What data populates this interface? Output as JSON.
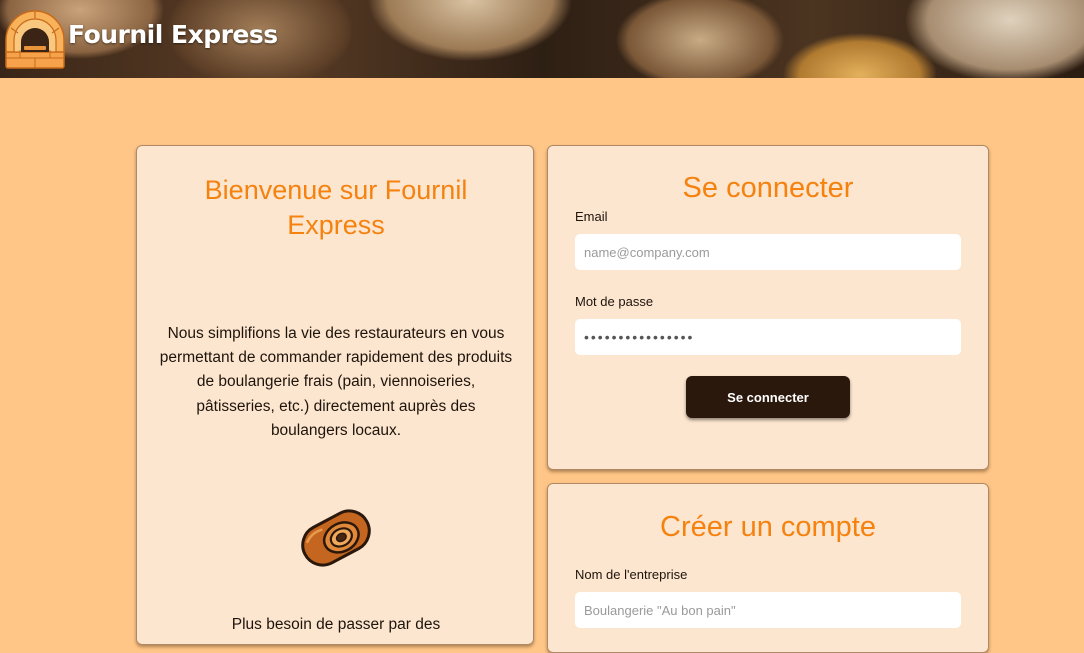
{
  "header": {
    "brand": "Fournil Express"
  },
  "welcome": {
    "title": "Bienvenue sur Fournil Express",
    "description": "Nous simplifions la vie des restaurateurs en vous permettant de commander rapidement des produits de boulangerie frais (pain, viennoiseries, pâtisseries, etc.) directement auprès des boulangers locaux.",
    "more_text": "Plus besoin de passer par des"
  },
  "login": {
    "title": "Se connecter",
    "email_label": "Email",
    "email_placeholder": "name@company.com",
    "password_label": "Mot de passe",
    "password_value": "••••••••••••••••",
    "submit_label": "Se connecter"
  },
  "signup": {
    "title": "Créer un compte",
    "company_label": "Nom de l'entreprise",
    "company_placeholder": "Boulangerie \"Au bon pain\""
  },
  "icons": {
    "logo": "bread-oven-icon",
    "illustration": "pain-au-chocolat-icon"
  },
  "colors": {
    "accent": "#f5820f",
    "background": "#ffc687",
    "card": "#fde6cf",
    "button": "#2b180c"
  }
}
